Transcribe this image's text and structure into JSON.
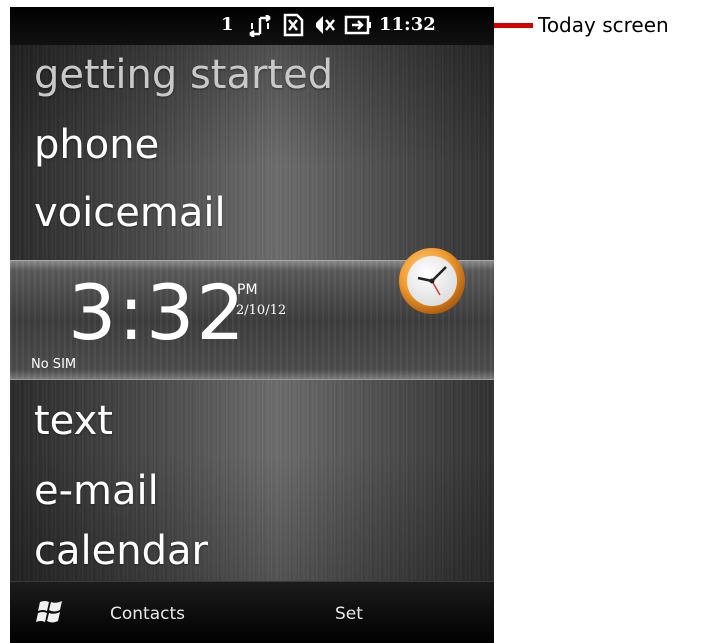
{
  "status_bar": {
    "signal_text": "1",
    "time": "11:32",
    "icons": [
      "data-sync-icon",
      "no-sim-icon",
      "speaker-muted-icon",
      "battery-charging-icon"
    ]
  },
  "menu": {
    "items": [
      {
        "label": "getting started"
      },
      {
        "label": "phone"
      },
      {
        "label": "voicemail"
      },
      {
        "label": "text"
      },
      {
        "label": "e-mail"
      },
      {
        "label": "calendar"
      }
    ]
  },
  "clock": {
    "time": "3:32",
    "ampm": "PM",
    "date": "2/10/12",
    "sim_status": "No SIM",
    "icon": "analog-clock-icon"
  },
  "bottom_bar": {
    "left_softkey": "Contacts",
    "right_softkey": "Set",
    "start_icon": "windows-start-icon"
  },
  "annotation": {
    "label": "Today screen",
    "color": "#d40000"
  }
}
